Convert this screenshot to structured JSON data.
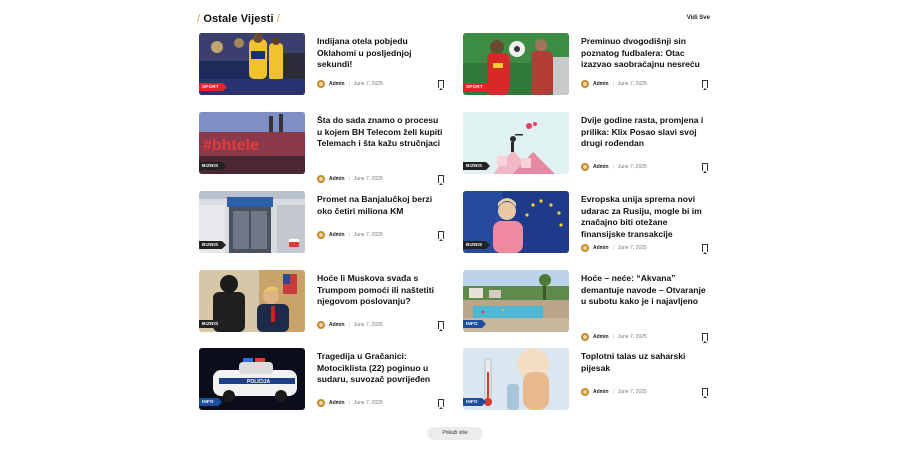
{
  "section": {
    "title": "Ostale Vijesti",
    "view_all": "Vidi Sve"
  },
  "articles": [
    {
      "headline": "Indijana otela pobjedu Oklahomi u posljednjoj sekundi!",
      "category": "SPORT",
      "author": "Admin",
      "date": "June 7, 2025"
    },
    {
      "headline": "Preminuo dvogodišnji sin poznatog fudbalera: Otac izazvao saobraćajnu nesreću",
      "category": "SPORT",
      "author": "Admin",
      "date": "June 7, 2025"
    },
    {
      "headline": "Šta do sada znamo o procesu u kojem BH Telecom želi kupiti Telemach i šta kažu stručnjaci",
      "category": "BIZNIS",
      "author": "Admin",
      "date": "June 7, 2025"
    },
    {
      "headline": "Dvije godine rasta, promjena i prilika: Klix Posao slavi svoj drugi rođendan",
      "category": "BIZNIS",
      "author": "Admin",
      "date": "June 7, 2025"
    },
    {
      "headline": "Promet na Banjalučkoj berzi oko četiri miliona KM",
      "category": "BIZNIS",
      "author": "Admin",
      "date": "June 7, 2025"
    },
    {
      "headline": "Evropska unija sprema novi udarac za Rusiju, mogle bi im značajno biti otežane finansijske transakcije",
      "category": "BIZNIS",
      "author": "Admin",
      "date": "June 7, 2025"
    },
    {
      "headline": "Hoće li Muskova svađa s Trumpom pomoći ili naštetiti njegovom poslovanju?",
      "category": "BIZNIS",
      "author": "Admin",
      "date": "June 7, 2025"
    },
    {
      "headline": "Hoće – neće: “Akvana” demantuje navode – Otvaranje u subotu kako je i najavljeno",
      "category": "INFO",
      "author": "Admin",
      "date": "June 7, 2025"
    },
    {
      "headline": "Tragedija u Gračanici: Motociklista (22) poginuo u sudaru, suvozač povrijeđen",
      "category": "INFO",
      "author": "Admin",
      "date": "June 7, 2025"
    },
    {
      "headline": "Toplotni talas uz saharski pijesak",
      "category": "INFO",
      "author": "Admin",
      "date": "June 7, 2025"
    }
  ],
  "load_more": "Prikaži više"
}
